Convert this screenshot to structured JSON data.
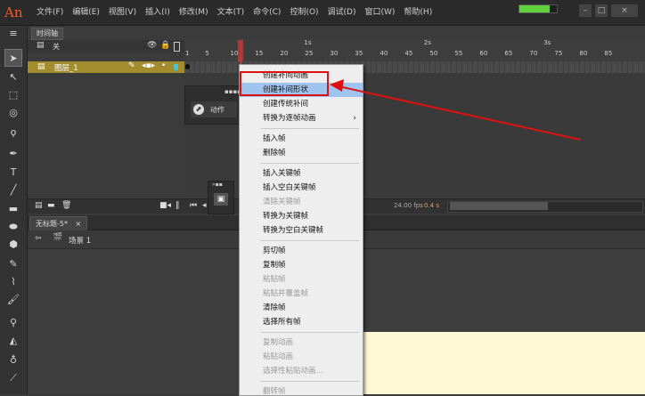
{
  "app": {
    "logo": "An"
  },
  "menubar": {
    "items": [
      "文件(F)",
      "编辑(E)",
      "视图(V)",
      "插入(I)",
      "修改(M)",
      "文本(T)",
      "命令(C)",
      "控制(O)",
      "调试(D)",
      "窗口(W)",
      "帮助(H)"
    ],
    "memory_fill_fraction": 0.8
  },
  "timeline": {
    "tab_label": "时间轴",
    "layer_header_glyph": "关",
    "layer_name": "图层_1",
    "ruler_frames": [
      "1",
      "5",
      "10",
      "15",
      "20",
      "25",
      "30",
      "35",
      "40",
      "45",
      "50",
      "55",
      "60",
      "65",
      "70",
      "75",
      "80",
      "85"
    ],
    "ruler_seconds": [
      "1s",
      "2s",
      "3s"
    ],
    "fps": "24.00 fps",
    "time": "0.4 s"
  },
  "actions_panel": {
    "label": "动作"
  },
  "document": {
    "tab_label": "无标题-5*",
    "scene_label": "场景 1"
  },
  "context_menu": {
    "items": [
      {
        "label": "创建补间动画",
        "enabled": true
      },
      {
        "label": "创建补间形状",
        "enabled": true,
        "highlighted": true
      },
      {
        "label": "创建传统补间",
        "enabled": true
      },
      {
        "label": "转换为逐帧动画",
        "enabled": true,
        "submenu": true
      },
      {
        "label": "插入帧",
        "enabled": true
      },
      {
        "label": "删除帧",
        "enabled": true
      },
      {
        "label": "插入关键帧",
        "enabled": true
      },
      {
        "label": "插入空白关键帧",
        "enabled": true
      },
      {
        "label": "清除关键帧",
        "enabled": false
      },
      {
        "label": "转换为关键帧",
        "enabled": true
      },
      {
        "label": "转换为空白关键帧",
        "enabled": true
      },
      {
        "label": "剪切帧",
        "enabled": true
      },
      {
        "label": "复制帧",
        "enabled": true
      },
      {
        "label": "粘贴帧",
        "enabled": false
      },
      {
        "label": "粘贴并覆盖帧",
        "enabled": false
      },
      {
        "label": "清除帧",
        "enabled": true
      },
      {
        "label": "选择所有帧",
        "enabled": true
      },
      {
        "label": "复制动画",
        "enabled": false
      },
      {
        "label": "粘贴动画",
        "enabled": false
      },
      {
        "label": "选择性粘贴动画...",
        "enabled": false
      },
      {
        "label": "翻转帧",
        "enabled": false
      }
    ],
    "submenu_glyph": "›"
  },
  "colors": {
    "highlight": "#9fc4ef",
    "annotation": "#e01010",
    "layer_row": "#a38c2e",
    "stage": "#fff8d6"
  },
  "icons": {
    "menu_glyph": "≡",
    "tools": [
      "selection-arrow-icon",
      "subselection-icon",
      "free-transform-icon",
      "3d-rotation-icon",
      "lasso-icon",
      "pen-icon",
      "text-icon",
      "line-icon",
      "rectangle-icon",
      "oval-icon",
      "polystar-icon",
      "pencil-icon",
      "brush-icon",
      "paint-brush-icon",
      "bone-icon",
      "paint-bucket-icon",
      "ink-bottle-icon",
      "eyedropper-icon"
    ]
  }
}
